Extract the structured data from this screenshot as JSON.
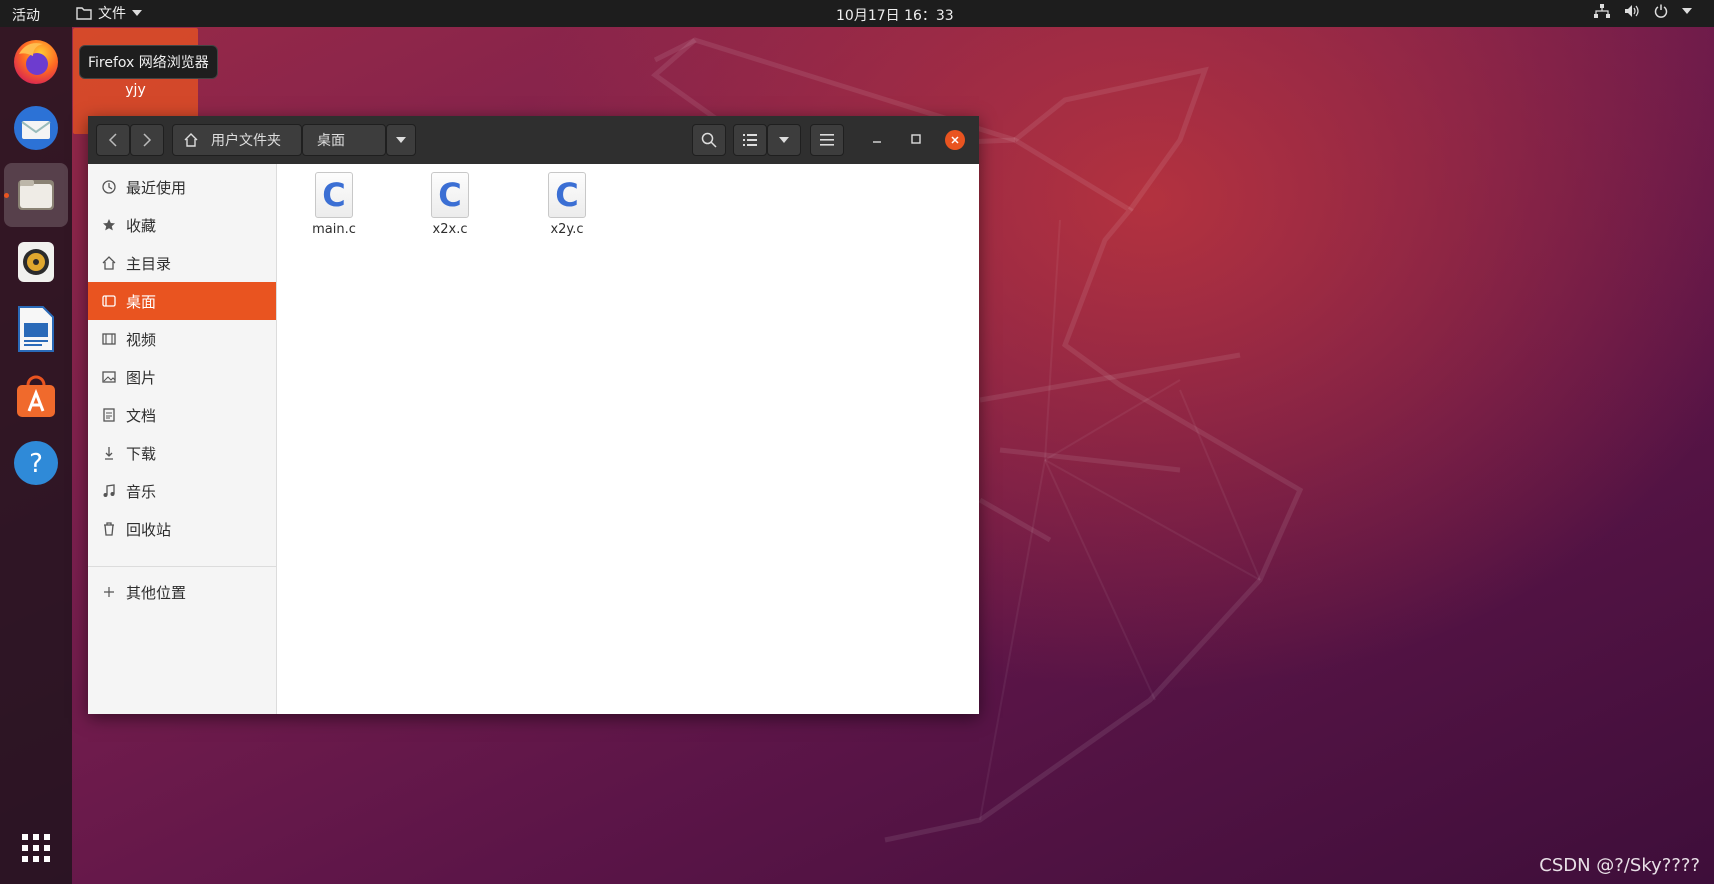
{
  "topbar": {
    "activities": "活动",
    "app_menu": "文件",
    "clock": "10月17日  16：33"
  },
  "dock": {
    "items": [
      {
        "name": "firefox"
      },
      {
        "name": "thunderbird"
      },
      {
        "name": "files"
      },
      {
        "name": "rhythmbox"
      },
      {
        "name": "libreoffice-writer"
      },
      {
        "name": "ubuntu-software"
      },
      {
        "name": "help"
      }
    ],
    "tooltip": "Firefox 网络浏览器"
  },
  "desktop": {
    "icon_label": "yjy"
  },
  "window": {
    "breadcrumb": {
      "home": "用户文件夹",
      "current": "桌面"
    },
    "sidebar": {
      "items": [
        {
          "label": "最近使用",
          "icon": "clock-icon"
        },
        {
          "label": "收藏",
          "icon": "star-icon"
        },
        {
          "label": "主目录",
          "icon": "home-icon"
        },
        {
          "label": "桌面",
          "icon": "desktop-icon",
          "selected": true
        },
        {
          "label": "视频",
          "icon": "film-icon"
        },
        {
          "label": "图片",
          "icon": "image-icon"
        },
        {
          "label": "文档",
          "icon": "document-icon"
        },
        {
          "label": "下载",
          "icon": "download-icon"
        },
        {
          "label": "音乐",
          "icon": "music-icon"
        },
        {
          "label": "回收站",
          "icon": "trash-icon"
        }
      ],
      "other": {
        "label": "其他位置",
        "icon": "plus-icon"
      }
    },
    "files": [
      {
        "name": "main.c",
        "glyph": "C"
      },
      {
        "name": "x2x.c",
        "glyph": "C"
      },
      {
        "name": "x2y.c",
        "glyph": "C"
      }
    ]
  },
  "watermark": "CSDN @?/Sky????",
  "colors": {
    "accent": "#e95420",
    "topbar": "#1d1d1d",
    "header": "#2f2f2f"
  }
}
